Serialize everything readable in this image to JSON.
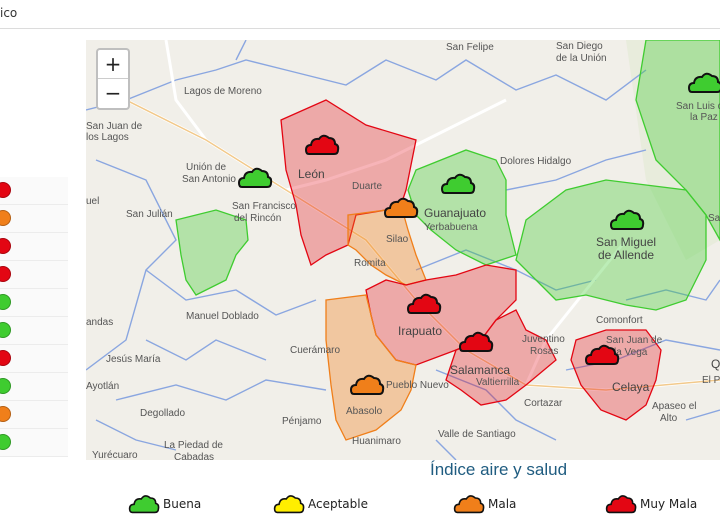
{
  "header": {
    "title_fragment": "ico"
  },
  "sidebar": {
    "statuses": [
      "#e30613",
      "#f07f1a",
      "#e30613",
      "#e30613",
      "#3fcc30",
      "#3fcc30",
      "#e30613",
      "#3fcc30",
      "#f07f1a",
      "#3fcc30"
    ]
  },
  "map": {
    "zoom_in": "+",
    "zoom_out": "−",
    "places": {
      "san_felipe": "San Felipe",
      "san_diego_1": "San Diego",
      "san_diego_2": "de la Unión",
      "lagos": "Lagos de Moreno",
      "sjl_1": "San Juan de",
      "sjl_2": "los Lagos",
      "union_1": "Unión de",
      "union_2": "San Antonio",
      "leon": "León",
      "duarte": "Duarte",
      "dolores": "Dolores Hidalgo",
      "guanajuato": "Guanajuato",
      "yerbabuena": "Yerbabuena",
      "sanfco_1": "San Francisco",
      "sanfco_2": "del Rincón",
      "san_julian": "San Julián",
      "silao": "Silao",
      "romita": "Romita",
      "sma_1": "San Miguel",
      "sma_2": "de Allende",
      "slp_1": "San Luis de",
      "slp_2": "la Paz",
      "manuel": "Manuel Doblado",
      "irapuato": "Irapuato",
      "comonfort": "Comonfort",
      "jesus_maria": "Jesús María",
      "cueramaro": "Cuerámaro",
      "juventino_1": "Juventino",
      "juventino_2": "Rosas",
      "sjv_1": "San Juan de",
      "sjv_2": "la Vega",
      "salamanca": "Salamanca",
      "valtierrilla": "Valtierrilla",
      "pueblo_nuevo": "Pueblo Nuevo",
      "celaya": "Celaya",
      "ayotlan": "Ayotlán",
      "abasolo": "Abasolo",
      "cortazar": "Cortazar",
      "apaseo_1": "Apaseo el",
      "apaseo_2": "Alto",
      "degollado": "Degollado",
      "penjamo": "Pénjamo",
      "piedad_1": "La Piedad de",
      "piedad_2": "Cabadas",
      "huanimaro": "Huanimaro",
      "valle": "Valle de Santiago",
      "yurecuaro": "Yurécuaro",
      "andas": "andas",
      "uel": "uel",
      "san": "San",
      "el_p": "El P",
      "q": "Q"
    },
    "zones": [
      {
        "name": "leon",
        "status": "Muy Mala",
        "color": "#e30613"
      },
      {
        "name": "sanfrancisco",
        "status": "Buena",
        "color": "#3fcc30"
      },
      {
        "name": "silao",
        "status": "Mala",
        "color": "#f07f1a"
      },
      {
        "name": "guanajuato",
        "status": "Buena",
        "color": "#3fcc30"
      },
      {
        "name": "sanmiguel",
        "status": "Buena",
        "color": "#3fcc30"
      },
      {
        "name": "sanluis",
        "status": "Buena",
        "color": "#3fcc30"
      },
      {
        "name": "irapuato",
        "status": "Muy Mala",
        "color": "#e30613"
      },
      {
        "name": "salamanca",
        "status": "Muy Mala",
        "color": "#e30613"
      },
      {
        "name": "abasolo",
        "status": "Mala",
        "color": "#f07f1a"
      },
      {
        "name": "celaya",
        "status": "Muy Mala",
        "color": "#e30613"
      }
    ]
  },
  "legend": {
    "title": "Índice aire y salud",
    "items": [
      {
        "label": "Buena",
        "color": "#3fcc30"
      },
      {
        "label": "Aceptable",
        "color": "#ffee00"
      },
      {
        "label": "Mala",
        "color": "#f07f1a"
      },
      {
        "label": "Muy Mala",
        "color": "#e30613"
      }
    ]
  }
}
